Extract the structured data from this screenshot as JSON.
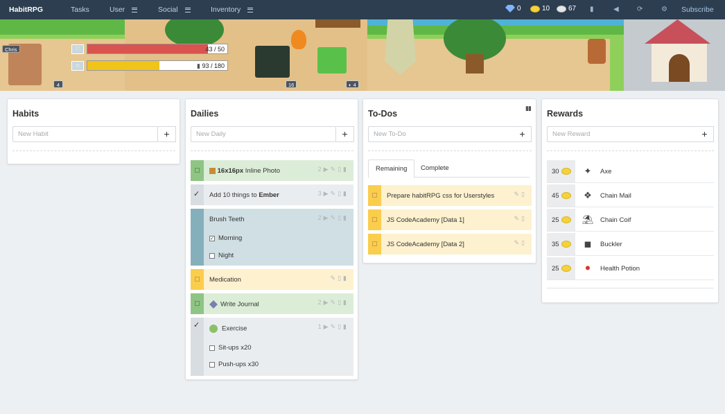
{
  "nav": {
    "brand": "HabitRPG",
    "items": [
      {
        "label": "Tasks"
      },
      {
        "label": "User"
      },
      {
        "label": "Social"
      },
      {
        "label": "Inventory"
      }
    ],
    "gems": "0",
    "gold": "10",
    "silver": "67",
    "subscribe": "Subscribe"
  },
  "header": {
    "player_name": "Chris",
    "health": {
      "text": "43 / 50",
      "value": 43,
      "max": 50,
      "color": "#d9534f"
    },
    "experience": {
      "text": "93 / 180",
      "value": 93,
      "max": 180,
      "color": "#f0c419"
    },
    "player_level": "4",
    "member2_level": "16",
    "member3_level": "4"
  },
  "habits": {
    "title": "Habits",
    "placeholder": "New Habit"
  },
  "dailies": {
    "title": "Dailies",
    "placeholder": "New Daily",
    "items": [
      {
        "text_bold": "16x16px",
        "text": " Inline Photo",
        "streak": "2"
      },
      {
        "text": "Add 10 things to ",
        "text_bold": "Ember",
        "streak": "3"
      },
      {
        "text": "Brush Teeth",
        "streak": "2",
        "checklist": [
          "Morning",
          "Night"
        ]
      },
      {
        "text": "Medication"
      },
      {
        "text": "Write Journal",
        "streak": "2"
      },
      {
        "text": "Exercise",
        "streak": "1",
        "checklist": [
          "Sit-ups x20",
          "Push-ups x30"
        ]
      }
    ]
  },
  "todos": {
    "title": "To-Dos",
    "placeholder": "New To-Do",
    "tabs": [
      "Remaining",
      "Complete"
    ],
    "items": [
      {
        "text": "Prepare habitRPG css for Userstyles"
      },
      {
        "text": "JS CodeAcademy [Data 1]"
      },
      {
        "text": "JS CodeAcademy [Data 2]"
      }
    ]
  },
  "rewards": {
    "title": "Rewards",
    "placeholder": "New Reward",
    "items": [
      {
        "cost": "30",
        "name": "Axe",
        "icon": "axe-icon"
      },
      {
        "cost": "45",
        "name": "Chain Mail",
        "icon": "chain-mail-icon"
      },
      {
        "cost": "25",
        "name": "Chain Coif",
        "icon": "chain-coif-icon"
      },
      {
        "cost": "35",
        "name": "Buckler",
        "icon": "buckler-icon"
      },
      {
        "cost": "25",
        "name": "Health Potion",
        "icon": "health-potion-icon"
      }
    ]
  }
}
